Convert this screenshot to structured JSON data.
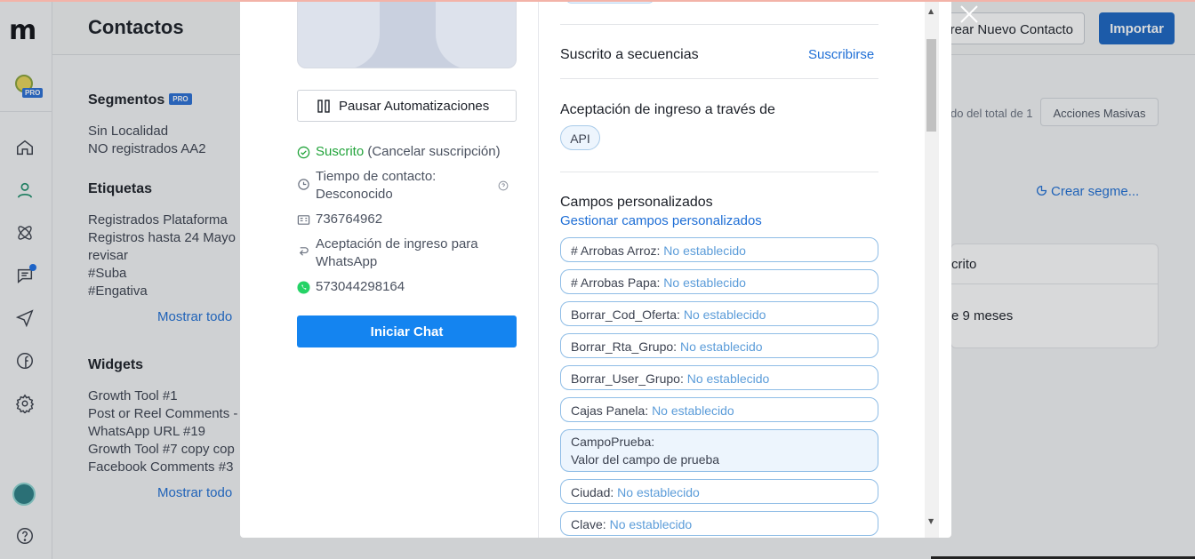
{
  "app": {
    "title": "Contactos",
    "account_badge": "PRO"
  },
  "header": {
    "create_contact": "Crear Nuevo Contacto",
    "import": "Importar"
  },
  "sidebar_bg": {
    "segments_title": "Segmentos",
    "segments_badge": "PRO",
    "segments": [
      "Sin Localidad",
      "NO registrados AA2"
    ],
    "tags_title": "Etiquetas",
    "tags": [
      "Registrados Plataforma",
      "Registros hasta 24 Mayo",
      "revisar",
      "#Suba",
      "#Engativa"
    ],
    "show_all": "Mostrar todo",
    "widgets_title": "Widgets",
    "widgets": [
      "Growth Tool #1",
      "Post or Reel Comments -",
      "WhatsApp URL #19",
      "Growth Tool #7 copy cop",
      "Facebook Comments #3"
    ]
  },
  "main_bg": {
    "total_text": "do del total de 1",
    "bulk_actions": "Acciones Masivas",
    "create_segment": "Crear segme...",
    "table_header": "crito",
    "table_cell": "e 9 meses"
  },
  "modal": {
    "pause_button": "Pausar Automatizaciones",
    "subscribed": "Suscrito",
    "unsubscribe": "(Cancelar suscripción)",
    "contact_time_label": "Tiempo de contacto:",
    "contact_time_value": "Desconocido",
    "contact_id": "736764962",
    "optin_whatsapp": "Aceptación de ingreso para WhatsApp",
    "phone": "573044298164",
    "start_chat": "Iniciar Chat",
    "sequences_title": "Suscrito a secuencias",
    "subscribe_link": "Suscribirse",
    "optin_title": "Aceptación de ingreso a través de",
    "optin_chip": "API",
    "custom_fields_title": "Campos personalizados",
    "manage_fields_link": "Gestionar campos personalizados",
    "custom_fields": [
      {
        "name": "# Arrobas Arroz:",
        "value": "No establecido"
      },
      {
        "name": "# Arrobas Papa:",
        "value": "No establecido"
      },
      {
        "name": "Borrar_Cod_Oferta:",
        "value": "No establecido"
      },
      {
        "name": "Borrar_Rta_Grupo:",
        "value": "No establecido"
      },
      {
        "name": "Borrar_User_Grupo:",
        "value": "No establecido"
      },
      {
        "name": "Cajas Panela:",
        "value": "No establecido"
      },
      {
        "name": "CampoPrueba:",
        "value": "Valor del campo de prueba"
      },
      {
        "name": "Ciudad:",
        "value": "No establecido"
      },
      {
        "name": "Clave:",
        "value": "No establecido"
      }
    ]
  },
  "colors": {
    "accent": "#1484f0",
    "brand_blue": "#1a66c4",
    "success": "#21a33a",
    "field_value": "#5b9cd9"
  },
  "icons": [
    "menu-logo-icon",
    "home-icon",
    "contacts-icon",
    "automation-icon",
    "chat-icon",
    "send-icon",
    "facebook-icon",
    "settings-icon",
    "help-icon",
    "close-icon",
    "pause-icon",
    "check-circle-icon",
    "clock-icon",
    "id-card-icon",
    "optin-icon",
    "whatsapp-icon",
    "pie-chart-icon"
  ]
}
